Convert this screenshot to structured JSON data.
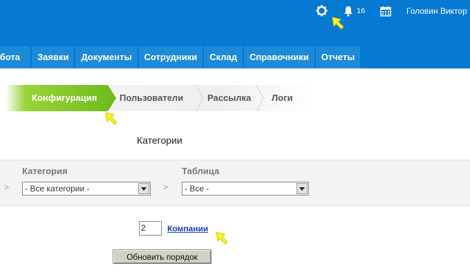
{
  "header": {
    "icons": [
      "gear-icon",
      "bell-icon",
      "calendar-icon"
    ],
    "notification_count": "16",
    "user_name": "Головин Виктор",
    "background_color": "#0679d2"
  },
  "nav": {
    "items": [
      {
        "label": "Работа"
      },
      {
        "label": "Заявки"
      },
      {
        "label": "Документы"
      },
      {
        "label": "Сотрудники"
      },
      {
        "label": "Склад"
      },
      {
        "label": "Справочники"
      },
      {
        "label": "Отчеты"
      }
    ],
    "color": "#1d8ad8"
  },
  "subtabs": {
    "active": "Конфигурация",
    "items": [
      "Пользователи",
      "Рассылка",
      "Логи"
    ],
    "active_color": "#6dbb1a"
  },
  "section": {
    "title": "Категории"
  },
  "filters": {
    "category": {
      "label": "Категория",
      "selected": "- Все категории -"
    },
    "table": {
      "label": "Таблица",
      "selected": "- Все -"
    },
    "separator": ">"
  },
  "order": {
    "value": "2",
    "link_text": "Компании",
    "update_button": "Обновить порядок"
  },
  "cursor_color": "#f5f52a"
}
